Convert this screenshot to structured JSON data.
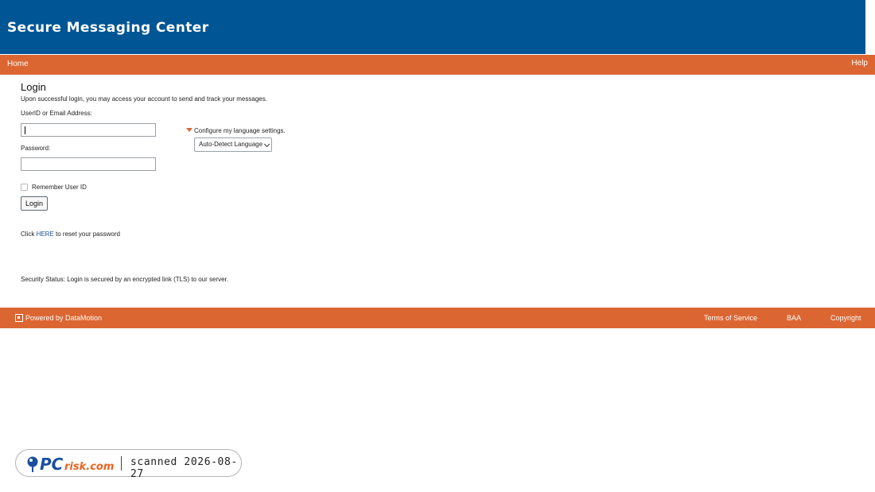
{
  "header": {
    "title": "Secure Messaging Center"
  },
  "nav": {
    "home_label": "Home",
    "help_label": "Help"
  },
  "login": {
    "title": "Login",
    "description": "Upon successful login, you may access your account to send and track your messages.",
    "userid_label": "UserID or Email Address:",
    "userid_value": "",
    "password_label": "Password:",
    "password_value": "",
    "remember_label": "Remember User ID",
    "remember_checked": false,
    "button_label": "Login",
    "reset_prefix": "Click ",
    "reset_link": "HERE",
    "reset_suffix": " to reset your password",
    "security_status": "Security Status: Login is secured by an encrypted link (TLS) to our server."
  },
  "language": {
    "toggle_label": "Configure my language settings.",
    "selected": "Auto-Detect Language"
  },
  "footer": {
    "powered_label": "Powered by DataMotion",
    "links": [
      "Terms of Service",
      "BAA",
      "Copyright"
    ]
  },
  "badge": {
    "logo_text": "PCrisk.com",
    "scan_text": "scanned 2026-08-27"
  },
  "colors": {
    "header_bg": "#005594",
    "accent": "#dc6632"
  }
}
